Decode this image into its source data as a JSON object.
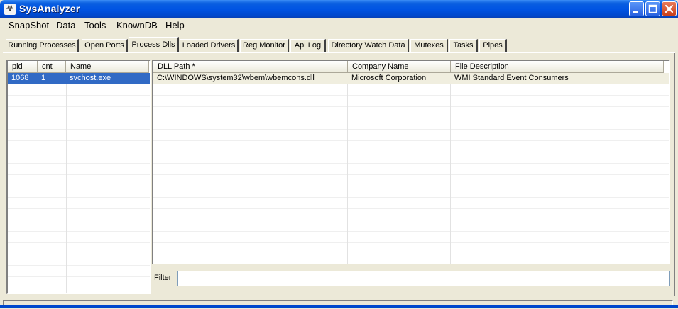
{
  "window": {
    "title": "SysAnalyzer",
    "app_icon": "biohazard-icon"
  },
  "menu": [
    "SnapShot",
    "Data",
    "Tools",
    "KnownDB",
    "Help"
  ],
  "tabs": [
    {
      "label": "Running Processes",
      "active": false
    },
    {
      "label": "Open Ports",
      "active": false
    },
    {
      "label": "Process Dlls",
      "active": true
    },
    {
      "label": "Loaded Drivers",
      "active": false
    },
    {
      "label": "Reg Monitor",
      "active": false
    },
    {
      "label": "Api Log",
      "active": false
    },
    {
      "label": "Directory Watch Data",
      "active": false
    },
    {
      "label": "Mutexes",
      "active": false
    },
    {
      "label": "Tasks",
      "active": false
    },
    {
      "label": "Pipes",
      "active": false
    }
  ],
  "process_list": {
    "columns": [
      "pid",
      "cnt",
      "Name"
    ],
    "rows": [
      {
        "pid": "1068",
        "cnt": "1",
        "name": "svchost.exe",
        "selected": true
      }
    ]
  },
  "dll_list": {
    "columns": [
      "DLL Path *",
      "Company Name",
      "File Description"
    ],
    "rows": [
      {
        "path": "C:\\WINDOWS\\system32\\wbem\\wbemcons.dll",
        "company": "Microsoft Corporation",
        "description": "WMI Standard Event Consumers"
      }
    ]
  },
  "filter": {
    "label": "Filter",
    "value": ""
  },
  "colors": {
    "title_bar": "#0054e3",
    "selection": "#316ac5",
    "face": "#ece9d8"
  }
}
